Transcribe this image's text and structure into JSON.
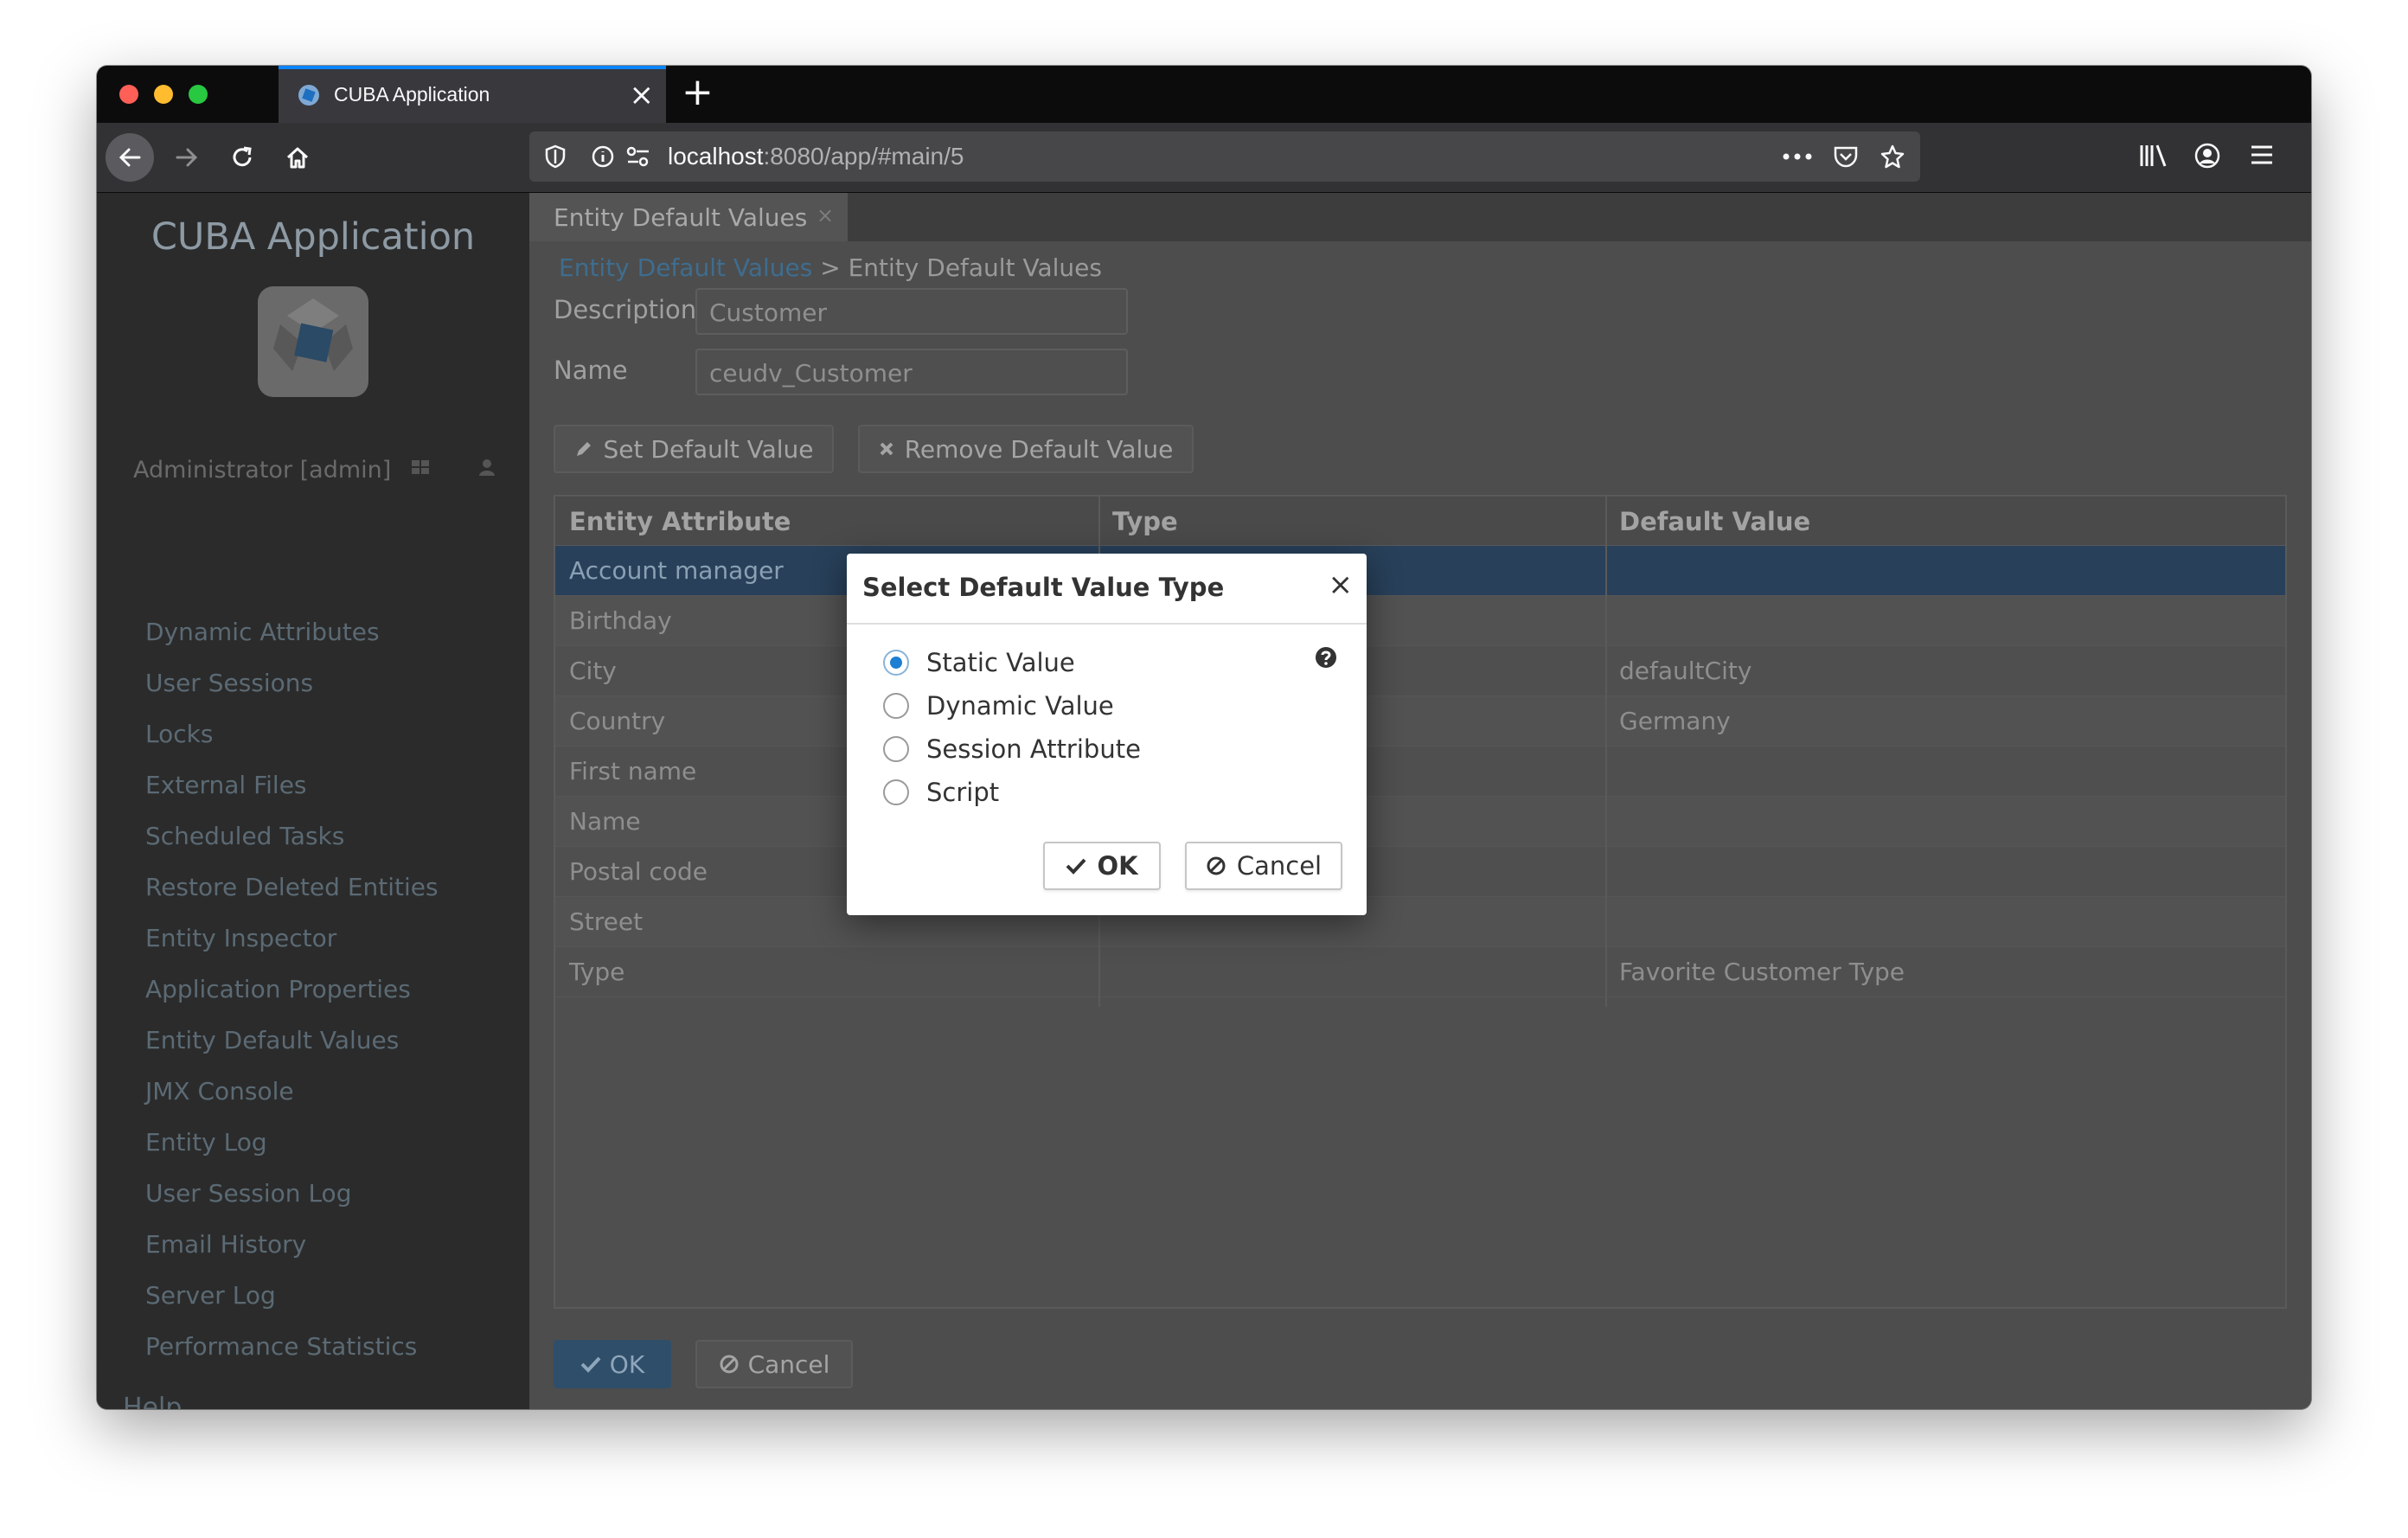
{
  "browser": {
    "tab_title": "CUBA Application",
    "url_host": "localhost",
    "url_rest": ":8080/app/#main/5"
  },
  "sidebar": {
    "app_title": "CUBA Application",
    "user_label": "Administrator [admin]",
    "menu_items": [
      "Dynamic Attributes",
      "User Sessions",
      "Locks",
      "External Files",
      "Scheduled Tasks",
      "Restore Deleted Entities",
      "Entity Inspector",
      "Application Properties",
      "Entity Default Values",
      "JMX Console",
      "Entity Log",
      "User Session Log",
      "Email History",
      "Server Log",
      "Performance Statistics"
    ],
    "help_label": "Help"
  },
  "main": {
    "tab_label": "Entity Default Values",
    "breadcrumb_link": "Entity Default Values",
    "breadcrumb_current": "> Entity Default Values",
    "description_label": "Description",
    "description_value": "Customer",
    "name_label": "Name",
    "name_value": "ceudv_Customer",
    "set_default_label": "Set Default Value",
    "remove_default_label": "Remove Default Value",
    "table": {
      "headers": [
        "Entity Attribute",
        "Type",
        "Default Value"
      ],
      "rows": [
        {
          "attribute": "Account manager",
          "type": "",
          "default": ""
        },
        {
          "attribute": "Birthday",
          "type": "",
          "default": ""
        },
        {
          "attribute": "City",
          "type": "",
          "default": "defaultCity"
        },
        {
          "attribute": "Country",
          "type": "",
          "default": "Germany"
        },
        {
          "attribute": "First name",
          "type": "",
          "default": ""
        },
        {
          "attribute": "Name",
          "type": "",
          "default": ""
        },
        {
          "attribute": "Postal code",
          "type": "",
          "default": ""
        },
        {
          "attribute": "Street",
          "type": "",
          "default": ""
        },
        {
          "attribute": "Type",
          "type": "",
          "default": "Favorite Customer Type"
        }
      ]
    },
    "ok_label": "OK",
    "cancel_label": "Cancel"
  },
  "dialog": {
    "title": "Select Default Value Type",
    "options": [
      "Static Value",
      "Dynamic Value",
      "Session Attribute",
      "Script"
    ],
    "selected_index": 0,
    "ok_label": "OK",
    "cancel_label": "Cancel"
  },
  "colors": {
    "accent": "#1d7fd3",
    "selected_row": "#28405a",
    "tab_highlight": "#0a84ff"
  }
}
